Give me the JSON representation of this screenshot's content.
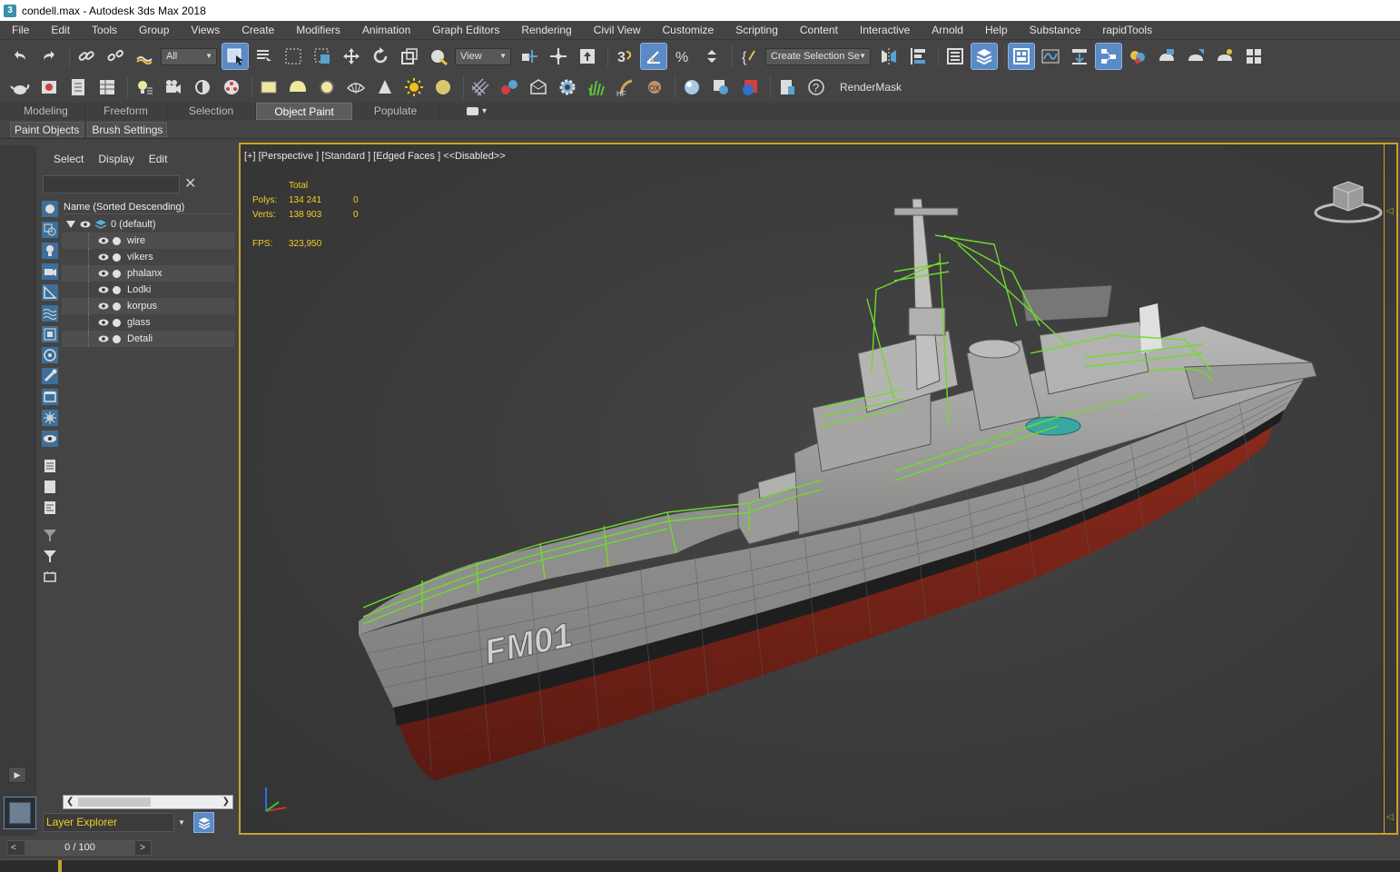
{
  "window": {
    "title": "condell.max - Autodesk 3ds Max 2018",
    "icon_letter": "3"
  },
  "menu": [
    "File",
    "Edit",
    "Tools",
    "Group",
    "Views",
    "Create",
    "Modifiers",
    "Animation",
    "Graph Editors",
    "Rendering",
    "Civil View",
    "Customize",
    "Scripting",
    "Content",
    "Interactive",
    "Arnold",
    "Help",
    "Substance",
    "rapidTools"
  ],
  "toolbar": {
    "filter_dropdown": "All",
    "refcoord_dropdown": "View",
    "named_selection_dropdown": "Create Selection Se",
    "rendermask_label": "RenderMask"
  },
  "ribbon": {
    "tabs": [
      "Modeling",
      "Freeform",
      "Selection",
      "Object Paint",
      "Populate"
    ],
    "active_tab": "Object Paint",
    "sub_buttons": [
      "Paint Objects",
      "Brush Settings"
    ]
  },
  "explorer": {
    "tabs": [
      "Select",
      "Display",
      "Edit"
    ],
    "search_value": "",
    "column_header": "Name (Sorted Descending)",
    "root_layer": "0 (default)",
    "layers": [
      "wire",
      "vikers",
      "phalanx",
      "Lodki",
      "korpus",
      "glass",
      "Detali"
    ],
    "explorer_type": "Layer Explorer"
  },
  "viewport": {
    "label": "[+] [Perspective ] [Standard ] [Edged Faces ]  <<Disabled>>",
    "stats_header": "Total",
    "stats": [
      {
        "key": "Polys:",
        "total": "134 241",
        "selected": "0"
      },
      {
        "key": "Verts:",
        "total": "138 903",
        "selected": "0"
      }
    ],
    "fps_key": "FPS:",
    "fps_value": "323,950",
    "hull_text": "FM01"
  },
  "timeslider": {
    "value": "0 / 100",
    "left_arrow": "<",
    "right_arrow": ">"
  },
  "colors": {
    "accent": "#5b8ac7",
    "viewport_border": "#c8a22a",
    "stats_text": "#f0d020",
    "wire_green": "#6edc2c"
  }
}
